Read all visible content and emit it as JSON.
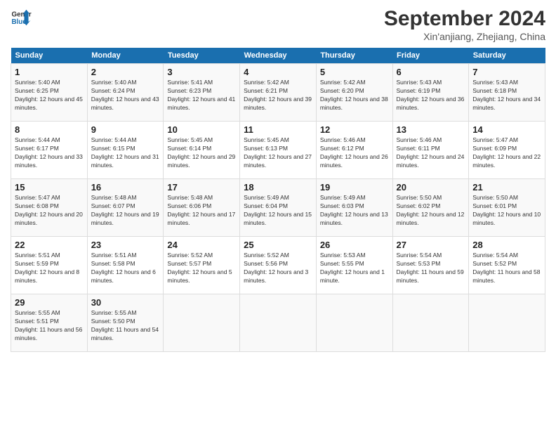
{
  "logo": {
    "line1": "General",
    "line2": "Blue"
  },
  "title": "September 2024",
  "subtitle": "Xin'anjiang, Zhejiang, China",
  "days_header": [
    "Sunday",
    "Monday",
    "Tuesday",
    "Wednesday",
    "Thursday",
    "Friday",
    "Saturday"
  ],
  "weeks": [
    [
      {
        "day": "1",
        "sunrise": "5:40 AM",
        "sunset": "6:25 PM",
        "daylight": "12 hours and 45 minutes."
      },
      {
        "day": "2",
        "sunrise": "5:40 AM",
        "sunset": "6:24 PM",
        "daylight": "12 hours and 43 minutes."
      },
      {
        "day": "3",
        "sunrise": "5:41 AM",
        "sunset": "6:23 PM",
        "daylight": "12 hours and 41 minutes."
      },
      {
        "day": "4",
        "sunrise": "5:42 AM",
        "sunset": "6:21 PM",
        "daylight": "12 hours and 39 minutes."
      },
      {
        "day": "5",
        "sunrise": "5:42 AM",
        "sunset": "6:20 PM",
        "daylight": "12 hours and 38 minutes."
      },
      {
        "day": "6",
        "sunrise": "5:43 AM",
        "sunset": "6:19 PM",
        "daylight": "12 hours and 36 minutes."
      },
      {
        "day": "7",
        "sunrise": "5:43 AM",
        "sunset": "6:18 PM",
        "daylight": "12 hours and 34 minutes."
      }
    ],
    [
      {
        "day": "8",
        "sunrise": "5:44 AM",
        "sunset": "6:17 PM",
        "daylight": "12 hours and 33 minutes."
      },
      {
        "day": "9",
        "sunrise": "5:44 AM",
        "sunset": "6:15 PM",
        "daylight": "12 hours and 31 minutes."
      },
      {
        "day": "10",
        "sunrise": "5:45 AM",
        "sunset": "6:14 PM",
        "daylight": "12 hours and 29 minutes."
      },
      {
        "day": "11",
        "sunrise": "5:45 AM",
        "sunset": "6:13 PM",
        "daylight": "12 hours and 27 minutes."
      },
      {
        "day": "12",
        "sunrise": "5:46 AM",
        "sunset": "6:12 PM",
        "daylight": "12 hours and 26 minutes."
      },
      {
        "day": "13",
        "sunrise": "5:46 AM",
        "sunset": "6:11 PM",
        "daylight": "12 hours and 24 minutes."
      },
      {
        "day": "14",
        "sunrise": "5:47 AM",
        "sunset": "6:09 PM",
        "daylight": "12 hours and 22 minutes."
      }
    ],
    [
      {
        "day": "15",
        "sunrise": "5:47 AM",
        "sunset": "6:08 PM",
        "daylight": "12 hours and 20 minutes."
      },
      {
        "day": "16",
        "sunrise": "5:48 AM",
        "sunset": "6:07 PM",
        "daylight": "12 hours and 19 minutes."
      },
      {
        "day": "17",
        "sunrise": "5:48 AM",
        "sunset": "6:06 PM",
        "daylight": "12 hours and 17 minutes."
      },
      {
        "day": "18",
        "sunrise": "5:49 AM",
        "sunset": "6:04 PM",
        "daylight": "12 hours and 15 minutes."
      },
      {
        "day": "19",
        "sunrise": "5:49 AM",
        "sunset": "6:03 PM",
        "daylight": "12 hours and 13 minutes."
      },
      {
        "day": "20",
        "sunrise": "5:50 AM",
        "sunset": "6:02 PM",
        "daylight": "12 hours and 12 minutes."
      },
      {
        "day": "21",
        "sunrise": "5:50 AM",
        "sunset": "6:01 PM",
        "daylight": "12 hours and 10 minutes."
      }
    ],
    [
      {
        "day": "22",
        "sunrise": "5:51 AM",
        "sunset": "5:59 PM",
        "daylight": "12 hours and 8 minutes."
      },
      {
        "day": "23",
        "sunrise": "5:51 AM",
        "sunset": "5:58 PM",
        "daylight": "12 hours and 6 minutes."
      },
      {
        "day": "24",
        "sunrise": "5:52 AM",
        "sunset": "5:57 PM",
        "daylight": "12 hours and 5 minutes."
      },
      {
        "day": "25",
        "sunrise": "5:52 AM",
        "sunset": "5:56 PM",
        "daylight": "12 hours and 3 minutes."
      },
      {
        "day": "26",
        "sunrise": "5:53 AM",
        "sunset": "5:55 PM",
        "daylight": "12 hours and 1 minute."
      },
      {
        "day": "27",
        "sunrise": "5:54 AM",
        "sunset": "5:53 PM",
        "daylight": "11 hours and 59 minutes."
      },
      {
        "day": "28",
        "sunrise": "5:54 AM",
        "sunset": "5:52 PM",
        "daylight": "11 hours and 58 minutes."
      }
    ],
    [
      {
        "day": "29",
        "sunrise": "5:55 AM",
        "sunset": "5:51 PM",
        "daylight": "11 hours and 56 minutes."
      },
      {
        "day": "30",
        "sunrise": "5:55 AM",
        "sunset": "5:50 PM",
        "daylight": "11 hours and 54 minutes."
      },
      null,
      null,
      null,
      null,
      null
    ]
  ]
}
